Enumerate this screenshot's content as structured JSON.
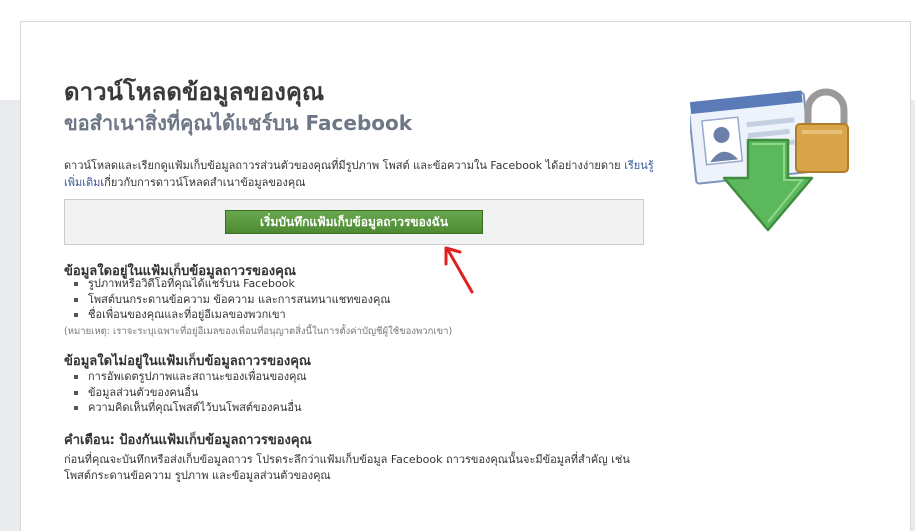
{
  "header": {
    "title": "ดาวน์โหลดข้อมูลของคุณ",
    "subtitle": "ขอสำเนาสิ่งที่คุณได้แชร์บน Facebook"
  },
  "intro": {
    "text_before_link": "ดาวน์โหลดและเรียกดูแฟ้มเก็บข้อมูลถาวรส่วนตัวของคุณที่มีรูปภาพ โพสต์ และข้อความใน Facebook ได้อย่างง่ายดาย ",
    "link_text": "เรียนรู้เพิ่มเติม",
    "text_after_link": "เกี่ยวกับการดาวน์โหลดสำเนาข้อมูลของคุณ"
  },
  "start_button": {
    "label": "เริ่มบันทึกแฟ้มเก็บข้อมูลถาวรของฉัน"
  },
  "included": {
    "title": "ข้อมูลใดอยู่ในแฟ้มเก็บข้อมูลถาวรของคุณ",
    "items": [
      "รูปภาพหรือวิดีโอที่คุณได้แชร์บน Facebook",
      "โพสต์บนกระดานข้อความ ข้อความ และการสนทนาแชทของคุณ",
      "ชื่อเพื่อนของคุณและที่อยู่อีเมลของพวกเขา"
    ],
    "note": "(หมายเหตุ: เราจะระบุเฉพาะที่อยู่อีเมลของเพื่อนที่อนุญาตสิ่งนี้ในการตั้งค่าบัญชีผู้ใช้ของพวกเขา)"
  },
  "not_included": {
    "title": "ข้อมูลใดไม่อยู่ในแฟ้มเก็บข้อมูลถาวรของคุณ",
    "items": [
      "การอัพเดตรูปภาพและสถานะของเพื่อนของคุณ",
      "ข้อมูลส่วนตัวของคนอื่น",
      "ความคิดเห็นที่คุณโพสต์ไว้บนโพสต์ของคนอื่น"
    ]
  },
  "warning": {
    "title": "คำเตือน: ป้องกันแฟ้มเก็บข้อมูลถาวรของคุณ",
    "text": "ก่อนที่คุณจะบันทึกหรือส่งเก็บข้อมูลถาวร โปรดระลึกว่าแฟ้มเก็บข้อมูล Facebook ถาวรของคุณนั้นจะมีข้อมูลที่สำคัญ เช่น โพสต์กระดานข้อความ รูปภาพ และข้อมูลส่วนตัวของคุณ"
  },
  "colors": {
    "button_green": "#4d8a33",
    "link_blue": "#3b5998",
    "annotation_red": "#e02020"
  },
  "icons": [
    "profile-card-icon",
    "padlock-icon",
    "download-arrow-icon",
    "annotation-arrow-icon"
  ]
}
